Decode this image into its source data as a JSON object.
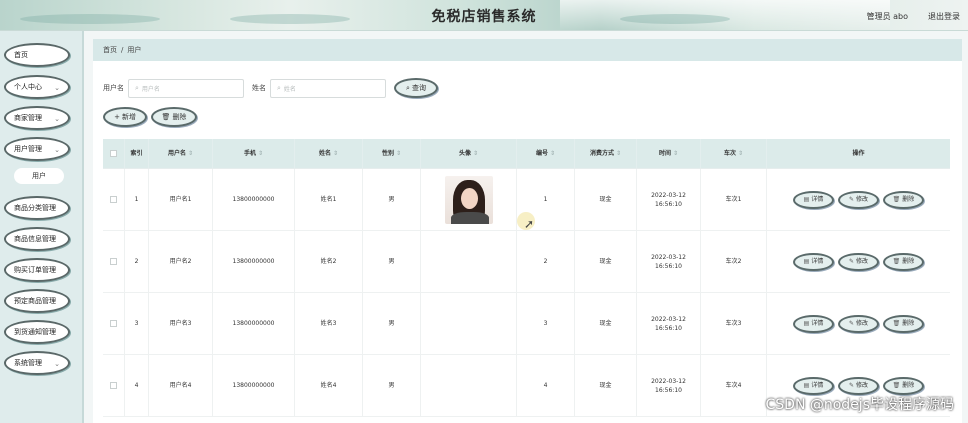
{
  "header": {
    "title": "免税店销售系统",
    "user_info": "管理员 abo",
    "logout_label": "退出登录"
  },
  "sidebar": {
    "items": [
      {
        "label": "首页",
        "chevron": ""
      },
      {
        "label": "个人中心",
        "chevron": "⌄"
      },
      {
        "label": "商家管理",
        "chevron": "⌄"
      },
      {
        "label": "用户管理",
        "chevron": "⌄"
      },
      {
        "label": "商品分类管理",
        "chevron": ""
      },
      {
        "label": "商品信息管理",
        "chevron": ""
      },
      {
        "label": "购买订单管理",
        "chevron": ""
      },
      {
        "label": "预定商品管理",
        "chevron": ""
      },
      {
        "label": "到货通知管理",
        "chevron": ""
      },
      {
        "label": "系统管理",
        "chevron": "⌄"
      }
    ],
    "sub_item": "用户"
  },
  "breadcrumb": {
    "home": "首页",
    "separator": "/",
    "current": "用户"
  },
  "search": {
    "username_label": "用户名",
    "username_placeholder": "用户名",
    "name_label": "姓名",
    "name_placeholder": "姓名",
    "query_button": "查询"
  },
  "actions": {
    "add": "新增",
    "delete": "删除"
  },
  "table": {
    "headers": [
      "索引",
      "用户名",
      "手机",
      "姓名",
      "性别",
      "头像",
      "编号",
      "消费方式",
      "时间",
      "车次",
      "操作"
    ],
    "rows": [
      {
        "index": "1",
        "username": "用户名1",
        "phone": "13800000000",
        "name": "姓名1",
        "gender": "男",
        "has_avatar": true,
        "number": "1",
        "method": "现金",
        "time": "2022-03-12 16:56:10",
        "train": "车次1"
      },
      {
        "index": "2",
        "username": "用户名2",
        "phone": "13800000000",
        "name": "姓名2",
        "gender": "男",
        "has_avatar": false,
        "number": "2",
        "method": "现金",
        "time": "2022-03-12 16:56:10",
        "train": "车次2"
      },
      {
        "index": "3",
        "username": "用户名3",
        "phone": "13800000000",
        "name": "姓名3",
        "gender": "男",
        "has_avatar": false,
        "number": "3",
        "method": "现金",
        "time": "2022-03-12 16:56:10",
        "train": "车次3"
      },
      {
        "index": "4",
        "username": "用户名4",
        "phone": "13800000000",
        "name": "姓名4",
        "gender": "男",
        "has_avatar": false,
        "number": "4",
        "method": "现金",
        "time": "2022-03-12 16:56:10",
        "train": "车次4"
      }
    ],
    "row_buttons": {
      "detail": "详情",
      "edit": "修改",
      "delete": "删除"
    }
  },
  "icons": {
    "search": "search-icon",
    "add": "plus-icon",
    "delete": "trash-icon",
    "detail": "document-icon",
    "edit": "pencil-icon",
    "sort": "sort-icon"
  },
  "colors": {
    "accent": "#dcebea",
    "sidebar_bg": "#dfecec",
    "button_border": "#5a6a6a"
  },
  "watermark": "CSDN @nodejs毕设程序源码"
}
